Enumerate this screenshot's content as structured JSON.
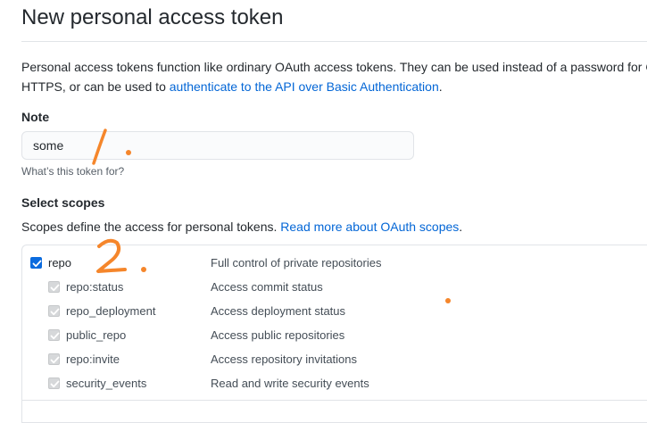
{
  "page": {
    "title": "New personal access token",
    "intro_text": "Personal access tokens function like ordinary OAuth access tokens. They can be used instead of a password for Git",
    "intro_text_2": "HTTPS, or can be used to ",
    "intro_link": "authenticate to the API over Basic Authentication",
    "intro_end": "."
  },
  "note": {
    "label": "Note",
    "value": "some",
    "hint": "What’s this token for?"
  },
  "scopes": {
    "label": "Select scopes",
    "desc_text": "Scopes define the access for personal tokens. ",
    "desc_link": "Read more about OAuth scopes",
    "desc_end": ".",
    "main": {
      "name": "repo",
      "desc": "Full control of private repositories",
      "checked": true
    },
    "sub": [
      {
        "name": "repo:status",
        "desc": "Access commit status"
      },
      {
        "name": "repo_deployment",
        "desc": "Access deployment status"
      },
      {
        "name": "public_repo",
        "desc": "Access public repositories"
      },
      {
        "name": "repo:invite",
        "desc": "Access repository invitations"
      },
      {
        "name": "security_events",
        "desc": "Read and write security events"
      }
    ]
  },
  "annotations": {
    "one": "1.",
    "two": "2.",
    "color": "#f5862b"
  },
  "colors": {
    "link": "#0366d6",
    "checkbox": "#0b6bde",
    "border": "#e1e4e8"
  }
}
